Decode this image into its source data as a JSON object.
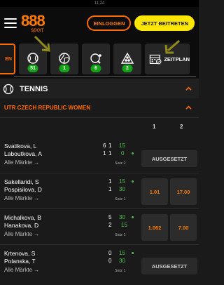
{
  "statusbar": {
    "time": "11:24"
  },
  "header": {
    "logo_main": "888",
    "logo_sub": "sport",
    "login_label": "EINLOGGEN",
    "join_label": "JETZT BEITRETEN"
  },
  "sports_bar": {
    "first_tile_label": "EN",
    "tiles": [
      {
        "icon": "tennis-ball-icon",
        "count": "51"
      },
      {
        "icon": "volleyball-icon",
        "count": "1"
      },
      {
        "icon": "table-tennis-icon",
        "count": "6"
      },
      {
        "icon": "snooker-icon",
        "count": "2"
      }
    ],
    "schedule_label": "ZEITPLAN"
  },
  "section": {
    "title": "TENNIS"
  },
  "league": {
    "title": "UTR CZECH REPUBLIC WOMEN"
  },
  "columns": {
    "c1": "1",
    "c2": "2"
  },
  "matches": [
    {
      "p1": "Svatikova, L",
      "p2": "Laboutkova, A",
      "s1a": "6",
      "s1b": "1",
      "s1c": "15",
      "s2a": "1",
      "s2b": "1",
      "s2c": "0",
      "serve": "p2",
      "period": "Satz 2",
      "more": "Alle Märkte →",
      "suspended": "AUSGESETZT"
    },
    {
      "p1": "Sakellaridi, S",
      "p2": "Pospisilova, D",
      "s1a": "1",
      "s1c": "15",
      "s2a": "1",
      "s2c": "30",
      "serve": "p1",
      "period": "Satz 1",
      "more": "Alle Märkte →",
      "odd1": "1.01",
      "odd2": "17.00"
    },
    {
      "p1": "Michalkova, B",
      "p2": "Hanakova, D",
      "s1a": "5",
      "s1c": "30",
      "s2a": "2",
      "s2c": "15",
      "serve": "p1",
      "period": "Satz 1",
      "more": "Alle Märkte →",
      "odd1": "1.062",
      "odd2": "7.00"
    },
    {
      "p1": "Krtenova, S",
      "p2": "Polanska, T",
      "s1a": "0",
      "s1c": "15",
      "s2a": "0",
      "s2c": "30",
      "serve": "p1",
      "period": "Satz 1",
      "more": "Alle Märkte →",
      "suspended": "AUSGESETZT"
    }
  ],
  "colors": {
    "accent": "#ff6a00",
    "join": "#ffe600",
    "badge": "#14a316",
    "live": "#4ec24e"
  }
}
